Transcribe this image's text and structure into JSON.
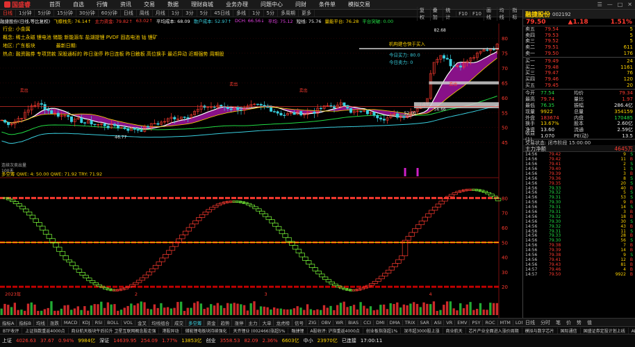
{
  "app": {
    "logo": "国盛睿",
    "menus": [
      "首页",
      "自选",
      "行情",
      "资讯",
      "交易",
      "数据",
      "理财商城",
      "业务办理",
      "问题中心",
      "问财",
      "条件单",
      "模拟交易"
    ]
  },
  "window_controls": [
    "☰",
    "—",
    "□",
    "✕"
  ],
  "toolbar": {
    "periods": [
      "日线",
      "1分钟",
      "5分钟",
      "15分钟",
      "30分钟",
      "60分钟",
      "日线",
      "周线",
      "月线",
      "1分",
      "3分",
      "5分",
      "45日线",
      "多线",
      "1分",
      "5分",
      "多周期",
      "更多"
    ],
    "selected_index": 0,
    "right": [
      "复权",
      "叠加",
      "统计",
      "F10",
      "F10",
      "画线",
      "均线",
      "指标"
    ]
  },
  "title_row": [
    {
      "text": "融捷股份(日线,等比复权)",
      "c": "wht"
    },
    {
      "text": "飞蝶栈先: 76.14↑",
      "c": "yel"
    },
    {
      "text": "主力资金: 79.82↑",
      "c": "red"
    },
    {
      "text": "63.02↑",
      "c": "red"
    },
    {
      "text": "平均成本: 68.09",
      "c": "wht"
    },
    {
      "text": "散户成本: 52.97↑",
      "c": "cyn"
    },
    {
      "text": "DCH: 66.56↓",
      "c": "mag"
    },
    {
      "text": "平均: 75.12",
      "c": "mag"
    },
    {
      "text": "短线: 75.76",
      "c": "wht"
    },
    {
      "text": "量能平台: 76.28",
      "c": "yel"
    },
    {
      "text": "平台突破: 0.00",
      "c": "grn"
    }
  ],
  "info": {
    "line1": "行业: 小金属",
    "line2": "概念: 稀土永磁 锂电池 储能 新能源车 盐湖提锂 PVDF 固态电池 钴 锂矿",
    "line3_k": "地区: 广东板块",
    "line3_v": "最新日期: ",
    "line4": "热点: 融资融券 专项贷款 深股通标的 昨日涨停 昨日连板 昨日触板 高位换手 最近异动 近期强势 周期股"
  },
  "chart_data": {
    "type": "candlestick",
    "price_axis": {
      "ticks": [
        80,
        75,
        70,
        65,
        60,
        55,
        50,
        45
      ],
      "ylim": [
        42,
        84
      ]
    },
    "osc_axis": {
      "ticks": [
        80,
        70,
        60,
        50,
        40,
        30,
        20
      ],
      "ylim": [
        14,
        90
      ]
    },
    "osc_title": "多空筹 QWE: 4: 50.00  QWE: 71.92  TRY: 71.92",
    "price_labels": {
      "high_mark": "82.68",
      "low_mark": "46.77",
      "mid_mark": "56.66",
      "mid_mark2": "52.00",
      "rise": "机构建仓快于买入",
      "today_buy": "今日买力: 80.0",
      "today_sell": "今日卖力: 0"
    },
    "red_tags": [
      "卖出",
      "卖出",
      "卖出",
      "卖出"
    ],
    "vol_title": "连续次卖出量",
    "vol_marker": "100天",
    "x_labels": [
      "2023年",
      "2",
      "3",
      "4"
    ],
    "month_labels": [
      "12",
      "2",
      "3",
      "4"
    ]
  },
  "right": {
    "name": "融捷股份",
    "code": "002192",
    "price": "79.50",
    "change": "▲1.18",
    "pct": "1.51%",
    "asks": [
      {
        "l": "卖五",
        "p": "79.54",
        "v": "5"
      },
      {
        "l": "卖四",
        "p": "79.53",
        "v": "5"
      },
      {
        "l": "卖三",
        "p": "79.52",
        "v": "5"
      },
      {
        "l": "卖二",
        "p": "79.51",
        "v": "611"
      },
      {
        "l": "卖一",
        "p": "79.50",
        "v": "176"
      }
    ],
    "bids": [
      {
        "l": "买一",
        "p": "79.49",
        "v": "24"
      },
      {
        "l": "买二",
        "p": "79.48",
        "v": "1161"
      },
      {
        "l": "买三",
        "p": "79.47",
        "v": "76"
      },
      {
        "l": "买四",
        "p": "79.46",
        "v": "120"
      },
      {
        "l": "买五",
        "p": "79.45",
        "v": "20"
      }
    ],
    "stats": [
      {
        "k": "今开",
        "a": "77.54",
        "ac": "grn",
        "k2": "均价",
        "b": "79.34",
        "bc": "red"
      },
      {
        "k": "最高",
        "a": "79.74",
        "ac": "red",
        "k2": "量比",
        "b": "1.97",
        "bc": "red"
      },
      {
        "k": "最低",
        "a": "76.35",
        "ac": "grn",
        "k2": "振幅",
        "b": "286.4亿",
        "bc": "wht"
      },
      {
        "k": "现量",
        "a": "9922",
        "ac": "yel",
        "k2": "总量",
        "b": "354159",
        "bc": "yel"
      },
      {
        "k": "外盘",
        "a": "183674",
        "ac": "red",
        "k2": "内盘",
        "b": "170485",
        "bc": "grn"
      },
      {
        "k": "换手",
        "a": "13.67%",
        "ac": "yel",
        "k2": "股本",
        "b": "2.60亿",
        "bc": "wht"
      },
      {
        "k": "净资",
        "a": "13.60",
        "ac": "wht",
        "k2": "流通",
        "b": "2.59亿",
        "bc": "wht"
      },
      {
        "k": "收益(1)",
        "a": "1.070",
        "ac": "wht",
        "k2": "PE(动)",
        "b": "13.5",
        "bc": "wht"
      }
    ],
    "trade_status": "交易状态: 闭市阶段 15:00:00",
    "main_flow_k": "主力净额",
    "main_flow_v": "4645万",
    "trades": [
      {
        "t": "14:56",
        "p": "79.42",
        "v": "9",
        "s": "S"
      },
      {
        "t": "14:56",
        "p": "79.42",
        "v": "11",
        "s": "B"
      },
      {
        "t": "14:56",
        "p": "79.41",
        "v": "2",
        "s": "S"
      },
      {
        "t": "14:56",
        "p": "79.40",
        "v": "1",
        "s": "S"
      },
      {
        "t": "14:56",
        "p": "79.39",
        "v": "3",
        "s": "B"
      },
      {
        "t": "14:56",
        "p": "79.36",
        "v": "8",
        "s": "S"
      },
      {
        "t": "14:56",
        "p": "79.35",
        "v": "20",
        "s": "S"
      },
      {
        "t": "14:56",
        "p": "79.33",
        "v": "40",
        "s": "B"
      },
      {
        "t": "14:56",
        "p": "79.32",
        "v": "5",
        "s": "S"
      },
      {
        "t": "14:56",
        "p": "79.31",
        "v": "53",
        "s": "S"
      },
      {
        "t": "14:56",
        "p": "79.30",
        "v": "9",
        "s": "B"
      },
      {
        "t": "14:56",
        "p": "79.31",
        "v": "14",
        "s": "S"
      },
      {
        "t": "14:56",
        "p": "79.31",
        "v": "3",
        "s": "B"
      },
      {
        "t": "14:56",
        "p": "79.32",
        "v": "18",
        "s": "B"
      },
      {
        "t": "14:56",
        "p": "79.30",
        "v": "30",
        "s": "S"
      },
      {
        "t": "14:56",
        "p": "79.32",
        "v": "43",
        "s": "B"
      },
      {
        "t": "14:56",
        "p": "79.31",
        "v": "11",
        "s": "S"
      },
      {
        "t": "14:56",
        "p": "79.33",
        "v": "28",
        "s": "B"
      },
      {
        "t": "14:56",
        "p": "79.30",
        "v": "56",
        "s": "S"
      },
      {
        "t": "14:56",
        "p": "79.38",
        "v": "7",
        "s": "B"
      },
      {
        "t": "14:56",
        "p": "79.39",
        "v": "14",
        "s": "B"
      },
      {
        "t": "14:56",
        "p": "79.38",
        "v": "9",
        "s": "S"
      },
      {
        "t": "14:56",
        "p": "79.41",
        "v": "12",
        "s": "B"
      },
      {
        "t": "14:56",
        "p": "79.43",
        "v": "81",
        "s": "B"
      },
      {
        "t": "14:57",
        "p": "79.46",
        "v": "4",
        "s": "B"
      },
      {
        "t": "14:57",
        "p": "79.50",
        "v": "9922",
        "s": "B"
      }
    ],
    "bottom_tabs": [
      "日线",
      "分时",
      "笔",
      "价",
      "势",
      "值"
    ]
  },
  "bottom_tabs": [
    "指标A",
    "指标B",
    "均线",
    "涨跌",
    "MACD",
    "KDJ",
    "RSI",
    "BOLL",
    "VOL",
    "金叉",
    "均线组合",
    "成交",
    "多空筹",
    "资金",
    "趋势",
    "涨停",
    "主力",
    "大单",
    "龙虎榜",
    "信号",
    "ZIG",
    "OBV",
    "WR",
    "BIAS",
    "CCI",
    "DMI",
    "DMA",
    "TRIX",
    "SAR",
    "ASI",
    "VR",
    "EMV",
    "PSY",
    "ROC",
    "MTM",
    "LONGTERM",
    "多空筹",
    "其他"
  ],
  "bottom_selected": 12,
  "news": [
    "BTF收评",
    "上证指数重返4000点",
    "商业航天板块午后拉升 卫星互联网概念股走强",
    "港股异动",
    "储能锂电板块持续强化",
    "天齐锂业 (002466)涨超5%",
    "融捷锂",
    "A股收评: 沪指重返4000点",
    "创业板指涨超1%",
    "深市超3000股上涨",
    "商业航天",
    "芯片产业全面进入涨价周期",
    "模拟与数字芯片",
    "国际通信",
    "国盛证券定投计划上线",
    "AI产业链"
  ],
  "statusbar": [
    {
      "t": "上证",
      "c": "wht"
    },
    {
      "t": "4026.63",
      "c": "red"
    },
    {
      "t": "37.67",
      "c": "red"
    },
    {
      "t": "0.94%",
      "c": "red"
    },
    {
      "t": "9984亿",
      "c": "yel"
    },
    {
      "t": "深证",
      "c": "wht"
    },
    {
      "t": "14639.95",
      "c": "red"
    },
    {
      "t": "254.09",
      "c": "red"
    },
    {
      "t": "1.77%",
      "c": "red"
    },
    {
      "t": "13853亿",
      "c": "yel"
    },
    {
      "t": "创业",
      "c": "wht"
    },
    {
      "t": "3558.53",
      "c": "red"
    },
    {
      "t": "82.09",
      "c": "red"
    },
    {
      "t": "2.36%",
      "c": "red"
    },
    {
      "t": "6603亿",
      "c": "yel"
    },
    {
      "t": "中小",
      "c": "wht"
    },
    {
      "t": "23970亿",
      "c": "yel"
    },
    {
      "t": "已连接",
      "c": "wht"
    },
    {
      "t": "17:00:11",
      "c": "wht"
    }
  ],
  "colors": {
    "up": "#ff3b30",
    "down": "#22dd44",
    "accent": "#ffd400",
    "cyan": "#39d0e0",
    "magenta": "#d020c8"
  }
}
